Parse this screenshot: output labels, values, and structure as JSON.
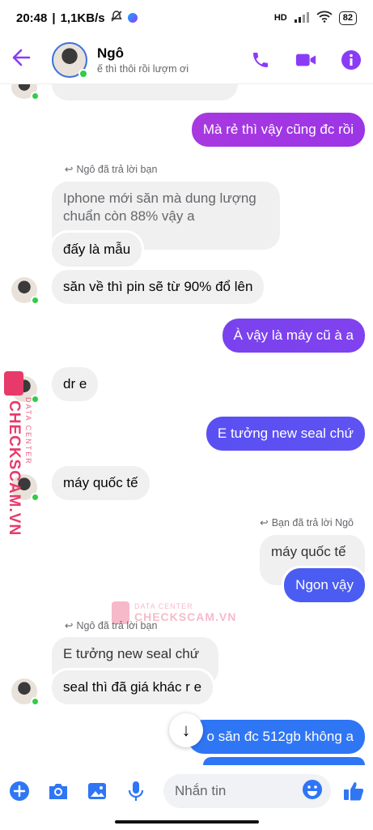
{
  "status_bar": {
    "time": "20:48",
    "speed": "1,1KB/s",
    "battery": "82",
    "hd": "HD"
  },
  "header": {
    "name": "Ngô",
    "status": "ế thì thôi rồi lượm ơi"
  },
  "colors": {
    "accent": "#8a3cf5",
    "bubble_in": "#f0f0f0",
    "online": "#31cc46"
  },
  "messages": {
    "m1": "Mà rẻ thì vậy cũng đc rồi",
    "reply1": "Ngô đã trả lời bạn",
    "q1a": "Iphone mới săn mà dung lượng",
    "q1b": "chuẩn còn 88% vậy a",
    "m2": "đấy là mẫu",
    "m3": "săn về thì pin sẽ từ 90% đổ lên",
    "m4": "À vậy là máy cũ à a",
    "m5": "dr e",
    "m6": "E tưởng new seal chứ",
    "m7": "máy quốc tế",
    "reply2": "Bạn đã trả lời Ngô",
    "q2": "máy quốc tế",
    "m8": "Ngon vậy",
    "reply3": "Ngô đã trả lời bạn",
    "q3": "E tưởng new seal chứ",
    "m9": "seal thì đã giá khác r e",
    "m10": "o săn đc 512gb không a"
  },
  "watermark": {
    "brand": "CHECKSCAM.VN",
    "sub": "DATA CENTER"
  },
  "composer": {
    "placeholder": "Nhắn tin"
  }
}
